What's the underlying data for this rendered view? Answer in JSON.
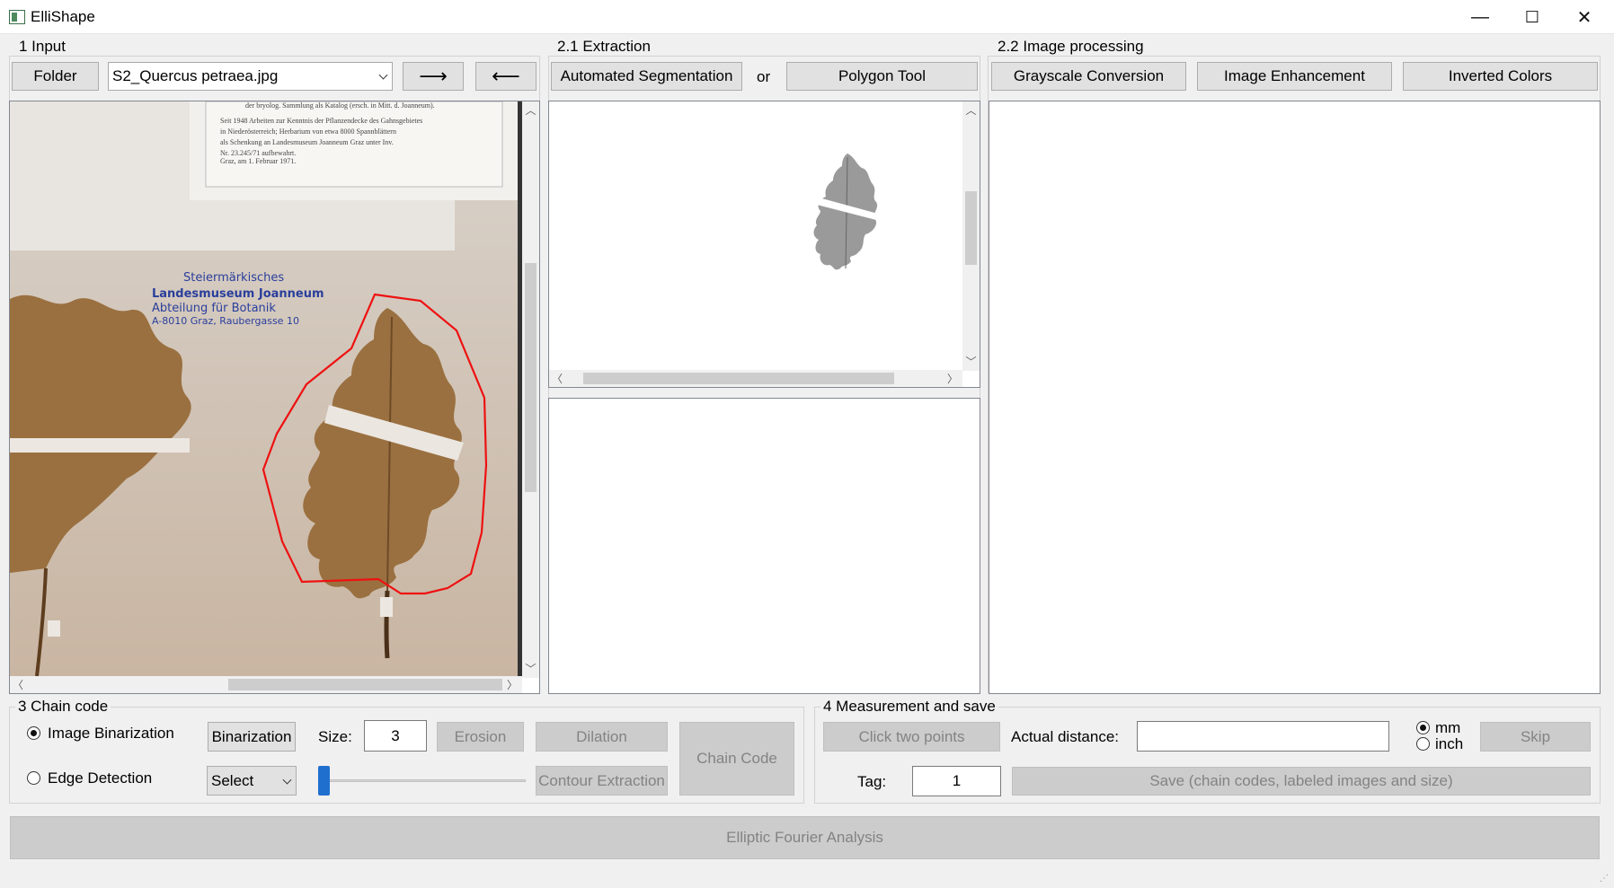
{
  "window": {
    "title": "ElliShape",
    "minimize": "—",
    "maximize": "☐",
    "close": "✕"
  },
  "input": {
    "group_title": "1 Input",
    "folder_label": "Folder",
    "file_select": "S2_Quercus petraea.jpg",
    "next_label": "⟶",
    "prev_label": "⟵"
  },
  "specimen_label": {
    "text_lines": [
      "der bryolog. Sammlung als Katalog (ersch. in Mitt. d. Joanneum).",
      "Seit 1948 Arbeiten zur Kenntnis der Pflanzendecke des Gahnsgebietes",
      "in Niederösterreich; Herbarium von etwa 8000 Spannblättern",
      "als Schenkung an Landesmuseum Joanneum Graz unter Inv.",
      "Nr. 23.245/71 aufbewahrt.",
      "Graz, am 1. Februar 1971."
    ]
  },
  "stamp": {
    "line1": "Steiermärkisches",
    "line2": "Landesmuseum Joanneum",
    "line3": "Abteilung für Botanik",
    "line4": "A-8010 Graz, Raubergasse 10"
  },
  "extraction": {
    "group_title": "2.1 Extraction",
    "auto_label": "Automated Segmentation",
    "or_label": "or",
    "polygon_label": "Polygon Tool"
  },
  "processing": {
    "group_title": "2.2 Image processing",
    "grayscale_label": "Grayscale Conversion",
    "enhance_label": "Image Enhancement",
    "invert_label": "Inverted Colors"
  },
  "chain": {
    "group_title": "3 Chain code",
    "binarization_radio": "Image Binarization",
    "edge_radio": "Edge Detection",
    "binarization_btn": "Binarization",
    "size_label": "Size:",
    "size_value": "3",
    "erosion_label": "Erosion",
    "dilation_label": "Dilation",
    "select_label": "Select",
    "contour_label": "Contour Extraction",
    "chain_code_label": "Chain Code",
    "slider_level": 0
  },
  "measure": {
    "group_title": "4 Measurement and save",
    "click_points_label": "Click two points",
    "actual_distance_label": "Actual distance:",
    "actual_distance_value": "",
    "unit_mm": "mm",
    "unit_inch": "inch",
    "skip_label": "Skip",
    "tag_label": "Tag:",
    "tag_value": "1",
    "save_label": "Save (chain codes, labeled images and size)"
  },
  "efa_label": "Elliptic Fourier Analysis",
  "colors": {
    "polygon": "#ee1111",
    "stamp_ink": "#2a3f9c",
    "leaf": "#9a7040",
    "paper": "#ddd5cb"
  }
}
